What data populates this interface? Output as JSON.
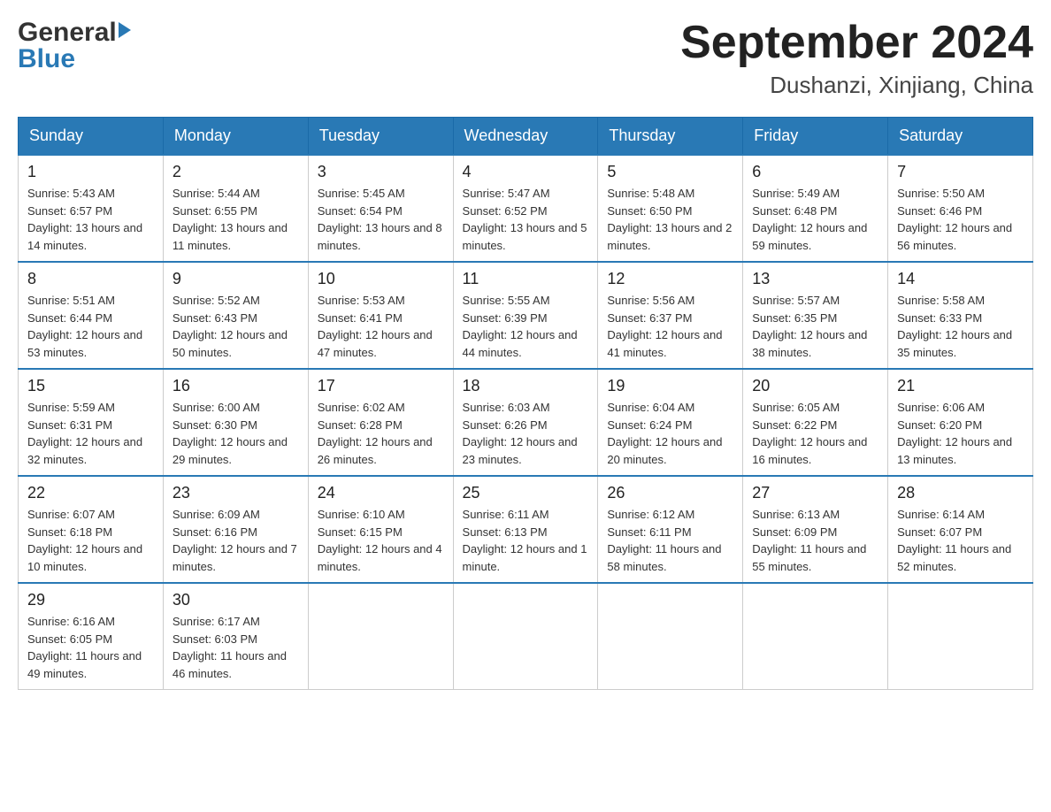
{
  "logo": {
    "general": "General",
    "blue": "Blue"
  },
  "title": "September 2024",
  "subtitle": "Dushanzi, Xinjiang, China",
  "days_of_week": [
    "Sunday",
    "Monday",
    "Tuesday",
    "Wednesday",
    "Thursday",
    "Friday",
    "Saturday"
  ],
  "weeks": [
    [
      {
        "date": "1",
        "sunrise": "Sunrise: 5:43 AM",
        "sunset": "Sunset: 6:57 PM",
        "daylight": "Daylight: 13 hours and 14 minutes."
      },
      {
        "date": "2",
        "sunrise": "Sunrise: 5:44 AM",
        "sunset": "Sunset: 6:55 PM",
        "daylight": "Daylight: 13 hours and 11 minutes."
      },
      {
        "date": "3",
        "sunrise": "Sunrise: 5:45 AM",
        "sunset": "Sunset: 6:54 PM",
        "daylight": "Daylight: 13 hours and 8 minutes."
      },
      {
        "date": "4",
        "sunrise": "Sunrise: 5:47 AM",
        "sunset": "Sunset: 6:52 PM",
        "daylight": "Daylight: 13 hours and 5 minutes."
      },
      {
        "date": "5",
        "sunrise": "Sunrise: 5:48 AM",
        "sunset": "Sunset: 6:50 PM",
        "daylight": "Daylight: 13 hours and 2 minutes."
      },
      {
        "date": "6",
        "sunrise": "Sunrise: 5:49 AM",
        "sunset": "Sunset: 6:48 PM",
        "daylight": "Daylight: 12 hours and 59 minutes."
      },
      {
        "date": "7",
        "sunrise": "Sunrise: 5:50 AM",
        "sunset": "Sunset: 6:46 PM",
        "daylight": "Daylight: 12 hours and 56 minutes."
      }
    ],
    [
      {
        "date": "8",
        "sunrise": "Sunrise: 5:51 AM",
        "sunset": "Sunset: 6:44 PM",
        "daylight": "Daylight: 12 hours and 53 minutes."
      },
      {
        "date": "9",
        "sunrise": "Sunrise: 5:52 AM",
        "sunset": "Sunset: 6:43 PM",
        "daylight": "Daylight: 12 hours and 50 minutes."
      },
      {
        "date": "10",
        "sunrise": "Sunrise: 5:53 AM",
        "sunset": "Sunset: 6:41 PM",
        "daylight": "Daylight: 12 hours and 47 minutes."
      },
      {
        "date": "11",
        "sunrise": "Sunrise: 5:55 AM",
        "sunset": "Sunset: 6:39 PM",
        "daylight": "Daylight: 12 hours and 44 minutes."
      },
      {
        "date": "12",
        "sunrise": "Sunrise: 5:56 AM",
        "sunset": "Sunset: 6:37 PM",
        "daylight": "Daylight: 12 hours and 41 minutes."
      },
      {
        "date": "13",
        "sunrise": "Sunrise: 5:57 AM",
        "sunset": "Sunset: 6:35 PM",
        "daylight": "Daylight: 12 hours and 38 minutes."
      },
      {
        "date": "14",
        "sunrise": "Sunrise: 5:58 AM",
        "sunset": "Sunset: 6:33 PM",
        "daylight": "Daylight: 12 hours and 35 minutes."
      }
    ],
    [
      {
        "date": "15",
        "sunrise": "Sunrise: 5:59 AM",
        "sunset": "Sunset: 6:31 PM",
        "daylight": "Daylight: 12 hours and 32 minutes."
      },
      {
        "date": "16",
        "sunrise": "Sunrise: 6:00 AM",
        "sunset": "Sunset: 6:30 PM",
        "daylight": "Daylight: 12 hours and 29 minutes."
      },
      {
        "date": "17",
        "sunrise": "Sunrise: 6:02 AM",
        "sunset": "Sunset: 6:28 PM",
        "daylight": "Daylight: 12 hours and 26 minutes."
      },
      {
        "date": "18",
        "sunrise": "Sunrise: 6:03 AM",
        "sunset": "Sunset: 6:26 PM",
        "daylight": "Daylight: 12 hours and 23 minutes."
      },
      {
        "date": "19",
        "sunrise": "Sunrise: 6:04 AM",
        "sunset": "Sunset: 6:24 PM",
        "daylight": "Daylight: 12 hours and 20 minutes."
      },
      {
        "date": "20",
        "sunrise": "Sunrise: 6:05 AM",
        "sunset": "Sunset: 6:22 PM",
        "daylight": "Daylight: 12 hours and 16 minutes."
      },
      {
        "date": "21",
        "sunrise": "Sunrise: 6:06 AM",
        "sunset": "Sunset: 6:20 PM",
        "daylight": "Daylight: 12 hours and 13 minutes."
      }
    ],
    [
      {
        "date": "22",
        "sunrise": "Sunrise: 6:07 AM",
        "sunset": "Sunset: 6:18 PM",
        "daylight": "Daylight: 12 hours and 10 minutes."
      },
      {
        "date": "23",
        "sunrise": "Sunrise: 6:09 AM",
        "sunset": "Sunset: 6:16 PM",
        "daylight": "Daylight: 12 hours and 7 minutes."
      },
      {
        "date": "24",
        "sunrise": "Sunrise: 6:10 AM",
        "sunset": "Sunset: 6:15 PM",
        "daylight": "Daylight: 12 hours and 4 minutes."
      },
      {
        "date": "25",
        "sunrise": "Sunrise: 6:11 AM",
        "sunset": "Sunset: 6:13 PM",
        "daylight": "Daylight: 12 hours and 1 minute."
      },
      {
        "date": "26",
        "sunrise": "Sunrise: 6:12 AM",
        "sunset": "Sunset: 6:11 PM",
        "daylight": "Daylight: 11 hours and 58 minutes."
      },
      {
        "date": "27",
        "sunrise": "Sunrise: 6:13 AM",
        "sunset": "Sunset: 6:09 PM",
        "daylight": "Daylight: 11 hours and 55 minutes."
      },
      {
        "date": "28",
        "sunrise": "Sunrise: 6:14 AM",
        "sunset": "Sunset: 6:07 PM",
        "daylight": "Daylight: 11 hours and 52 minutes."
      }
    ],
    [
      {
        "date": "29",
        "sunrise": "Sunrise: 6:16 AM",
        "sunset": "Sunset: 6:05 PM",
        "daylight": "Daylight: 11 hours and 49 minutes."
      },
      {
        "date": "30",
        "sunrise": "Sunrise: 6:17 AM",
        "sunset": "Sunset: 6:03 PM",
        "daylight": "Daylight: 11 hours and 46 minutes."
      },
      null,
      null,
      null,
      null,
      null
    ]
  ]
}
